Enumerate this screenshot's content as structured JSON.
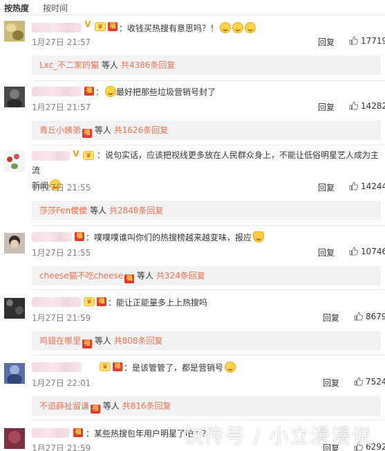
{
  "sort": {
    "by_hot": "按热度",
    "by_time": "按时间"
  },
  "comments": [
    {
      "text": "：收钱买热搜有意思吗？！",
      "time": "1月27日 21:57",
      "reply": "回复",
      "likes": "17719",
      "sub": {
        "user": "Lxc_不二家的猫",
        "mid": " 等人 ",
        "count": "共4386条回复"
      }
    },
    {
      "text": "最好把那些垃圾营销号封了",
      "time": "1月27日 21:57",
      "reply": "回复",
      "likes": "14282",
      "sub": {
        "user": "青丘小姨弟",
        "mid": " 等人 ",
        "count": "共1626条回复"
      }
    },
    {
      "text_line1": "：说句实话，应该把视线更多放在人民群众身上，不能让低俗明星艺人成为主流",
      "text_line2": "新闻",
      "time": "1月27日 21:55",
      "reply": "回复",
      "likes": "14244",
      "sub": {
        "user": "莎莎Fen傻傻",
        "mid": " 等人 ",
        "count": "共2848条回复"
      }
    },
    {
      "text": "：噗噗噗谁叫你们的热搜榜越来越变味，报应",
      "time": "1月27日 21:55",
      "reply": "回复",
      "likes": "10746",
      "sub": {
        "user": "cheese猫不吃cheese",
        "mid": " 等人 ",
        "count": "共324条回复"
      }
    },
    {
      "text": "：能让正能量多上上热搜吗",
      "time": "1月27日 21:59",
      "reply": "回复",
      "likes": "8679",
      "sub": {
        "user": "鸡翅在哪里",
        "mid": " 等人 ",
        "count": "共808条回复"
      }
    },
    {
      "text": "：是该管管了，都是营销号",
      "time": "1月27日 22:01",
      "reply": "回复",
      "likes": "7524",
      "sub": {
        "user": "不追薛祉留谦",
        "mid": " 等人 ",
        "count": "共816条回复"
      }
    },
    {
      "text": "：某些热搜包年用户明星了吧？？",
      "time": "1月27日 21:59",
      "reply": "回复",
      "likes": "6292"
    }
  ],
  "watermark": "快传号 / 小立漫漫说",
  "colors": {
    "link": "#eb7350",
    "subreply_bg": "#f2f2f5",
    "time": "#808080"
  }
}
